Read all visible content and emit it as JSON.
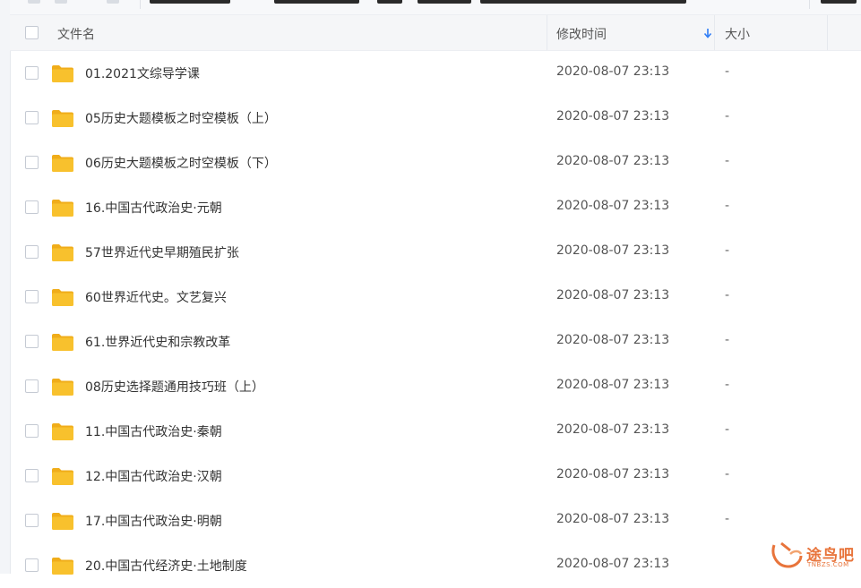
{
  "header": {
    "filename_label": "文件名",
    "modified_label": "修改时间",
    "size_label": "大小"
  },
  "files": [
    {
      "name": "01.2021文综导学课",
      "modified": "2020-08-07 23:13",
      "size": "-"
    },
    {
      "name": "05历史大题模板之时空模板（上）",
      "modified": "2020-08-07 23:13",
      "size": "-"
    },
    {
      "name": "06历史大题模板之时空模板（下）",
      "modified": "2020-08-07 23:13",
      "size": "-"
    },
    {
      "name": "16.中国古代政治史·元朝",
      "modified": "2020-08-07 23:13",
      "size": "-"
    },
    {
      "name": "57世界近代史早期殖民扩张",
      "modified": "2020-08-07 23:13",
      "size": "-"
    },
    {
      "name": "60世界近代史。文艺复兴",
      "modified": "2020-08-07 23:13",
      "size": "-"
    },
    {
      "name": "61.世界近代史和宗教改革",
      "modified": "2020-08-07 23:13",
      "size": "-"
    },
    {
      "name": "08历史选择题通用技巧班（上）",
      "modified": "2020-08-07 23:13",
      "size": "-"
    },
    {
      "name": "11.中国古代政治史·秦朝",
      "modified": "2020-08-07 23:13",
      "size": "-"
    },
    {
      "name": "12.中国古代政治史·汉朝",
      "modified": "2020-08-07 23:13",
      "size": "-"
    },
    {
      "name": "17.中国古代政治史·明朝",
      "modified": "2020-08-07 23:13",
      "size": "-"
    },
    {
      "name": "20.中国古代经济史·土地制度",
      "modified": "2020-08-07 23:13",
      "size": ""
    }
  ],
  "watermark": {
    "text": "途鸟吧",
    "sub": "TNBZS.COM"
  },
  "colors": {
    "folder": "#f8c12d",
    "folder_back": "#f0ad1a",
    "sort_arrow": "#2f7df6",
    "watermark": "#e8743b"
  }
}
